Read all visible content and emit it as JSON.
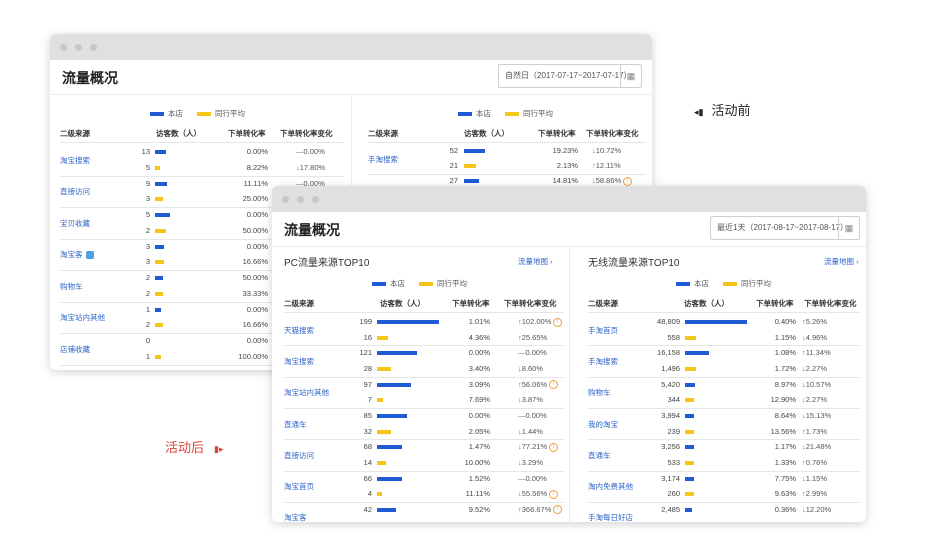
{
  "colors": {
    "self": "#1f5bd6",
    "peer": "#f5c518",
    "link": "#2d64c8",
    "up": "#e0443a",
    "down": "#2e9e3a",
    "after_label": "#e0443a"
  },
  "labels": {
    "before": "活动前",
    "after": "活动后",
    "before_icon": "◂▮",
    "after_icon": "▮▸"
  },
  "win1": {
    "title": "流量概况",
    "date": "自然日（2017-07-17~2017-07-17）",
    "legend": {
      "self": "本店",
      "peer": "同行平均"
    },
    "headers": [
      "二级来源",
      "访客数（人）",
      "下单转化率",
      "下单转化率变化"
    ],
    "left": {
      "rows": [
        {
          "name": "淘宝搜索",
          "tag": false,
          "v1": "13",
          "b1": 0.38,
          "v2": "5",
          "b2": 0.18,
          "r1": "0.00%",
          "r2": "8.22%",
          "c": "0.00%",
          "cd": "eq",
          "c2": "17.80%",
          "cd2": "down"
        },
        {
          "name": "直接访问",
          "tag": false,
          "v1": "9",
          "b1": 0.42,
          "v2": "3",
          "b2": 0.3,
          "r1": "11.11%",
          "r2": "25.00%",
          "c": "0.00%",
          "cd": "eq"
        },
        {
          "name": "宝贝收藏",
          "tag": false,
          "v1": "5",
          "b1": 0.55,
          "v2": "2",
          "b2": 0.38,
          "r1": "0.00%",
          "r2": "50.00%"
        },
        {
          "name": "淘宝客",
          "tag": true,
          "v1": "3",
          "b1": 0.33,
          "v2": "3",
          "b2": 0.33,
          "r1": "0.00%",
          "r2": "16.66%"
        },
        {
          "name": "购物车",
          "tag": false,
          "v1": "2",
          "b1": 0.3,
          "v2": "2",
          "b2": 0.3,
          "r1": "50.00%",
          "r2": "33.33%"
        },
        {
          "name": "淘宝站内其他",
          "tag": false,
          "v1": "1",
          "b1": 0.2,
          "v2": "2",
          "b2": 0.3,
          "r1": "0.00%",
          "r2": "16.66%"
        },
        {
          "name": "店铺收藏",
          "tag": false,
          "v1": "0",
          "b1": 0.0,
          "v2": "1",
          "b2": 0.2,
          "r1": "0.00%",
          "r2": "100.00%"
        }
      ]
    },
    "right": {
      "rows": [
        {
          "name": "手淘搜索",
          "v1": "52",
          "b1": 0.42,
          "v2": "21",
          "b2": 0.24,
          "v3": "27",
          "b3": 0.3,
          "r1": "19.23%",
          "r2": "2.13%",
          "r3": "14.81%",
          "c1": "10.72%",
          "cd1": "down",
          "c2": "12.11%",
          "cd2": "up",
          "c3": "58.86%",
          "cd3": "down"
        }
      ]
    }
  },
  "win2": {
    "title": "流量概况",
    "date": "最近1天（2017-08-17~2017-08-17）",
    "legend": {
      "self": "本店",
      "peer": "同行平均"
    },
    "headers": [
      "二级来源",
      "访客数（人）",
      "下单转化率",
      "下单转化率变化"
    ],
    "left": {
      "title": "PC流量来源TOP10",
      "map": "流量地图 ›",
      "rows": [
        {
          "name": "天猫搜索",
          "v1": "199",
          "b1": 1.0,
          "v2": "16",
          "b2": 0.18,
          "r1": "1.01%",
          "r2": "4.36%",
          "c1": "102.00%",
          "cd1": "up",
          "w1": true,
          "c2": "25.65%",
          "cd2": "up"
        },
        {
          "name": "淘宝搜索",
          "v1": "121",
          "b1": 0.65,
          "v2": "28",
          "b2": 0.22,
          "r1": "0.00%",
          "r2": "3.40%",
          "c1": "0.00%",
          "cd1": "eq",
          "c2": "8.60%",
          "cd2": "down"
        },
        {
          "name": "淘宝站内其他",
          "v1": "97",
          "b1": 0.55,
          "v2": "7",
          "b2": 0.1,
          "r1": "3.09%",
          "r2": "7.69%",
          "c1": "56.06%",
          "cd1": "up",
          "w1": true,
          "c2": "3.87%",
          "cd2": "down"
        },
        {
          "name": "直通车",
          "v1": "85",
          "b1": 0.48,
          "v2": "32",
          "b2": 0.22,
          "r1": "0.00%",
          "r2": "2.05%",
          "c1": "0.00%",
          "cd1": "eq",
          "c2": "1.44%",
          "cd2": "down"
        },
        {
          "name": "直接访问",
          "v1": "68",
          "b1": 0.4,
          "v2": "14",
          "b2": 0.14,
          "r1": "1.47%",
          "r2": "10.00%",
          "c1": "77.21%",
          "cd1": "down",
          "w1": true,
          "c2": "3.29%",
          "cd2": "down"
        },
        {
          "name": "淘宝首页",
          "v1": "66",
          "b1": 0.4,
          "v2": "4",
          "b2": 0.08,
          "r1": "1.52%",
          "r2": "11.11%",
          "c1": "0.00%",
          "cd1": "eq",
          "c2": "55.56%",
          "cd2": "down",
          "w2": true
        },
        {
          "name": "淘宝客",
          "v1": "42",
          "b1": 0.3,
          "v2": "",
          "b2": 0.0,
          "r1": "9.52%",
          "r2": "",
          "c1": "366.67%",
          "cd1": "up",
          "w1": true,
          "c2": "",
          "cd2": "eq"
        }
      ]
    },
    "right": {
      "title": "无线流量来源TOP10",
      "map": "流量地图 ›",
      "rows": [
        {
          "name": "手淘首页",
          "v1": "48,809",
          "b1": 1.0,
          "v2": "558",
          "b2": 0.18,
          "r1": "0.40%",
          "r2": "1.15%",
          "c1": "5.26%",
          "cd1": "up",
          "c2": "4.96%",
          "cd2": "down"
        },
        {
          "name": "手淘搜索",
          "v1": "16,158",
          "b1": 0.38,
          "v2": "1,496",
          "b2": 0.18,
          "r1": "1.08%",
          "r2": "1.72%",
          "c1": "11.34%",
          "cd1": "up",
          "c2": "2.27%",
          "cd2": "down"
        },
        {
          "name": "购物车",
          "v1": "5,420",
          "b1": 0.16,
          "v2": "344",
          "b2": 0.14,
          "r1": "8.97%",
          "r2": "12.90%",
          "c1": "10.57%",
          "cd1": "down",
          "c2": "2.27%",
          "cd2": "down"
        },
        {
          "name": "我的淘宝",
          "v1": "3,994",
          "b1": 0.14,
          "v2": "239",
          "b2": 0.14,
          "r1": "8.64%",
          "r2": "13.56%",
          "c1": "15.13%",
          "cd1": "down",
          "c2": "1.73%",
          "cd2": "up"
        },
        {
          "name": "直通车",
          "v1": "3,256",
          "b1": 0.14,
          "v2": "533",
          "b2": 0.14,
          "r1": "1.17%",
          "r2": "1.33%",
          "c1": "21.48%",
          "cd1": "down",
          "c2": "0.76%",
          "cd2": "up"
        },
        {
          "name": "淘内免费其他",
          "v1": "3,174",
          "b1": 0.14,
          "v2": "260",
          "b2": 0.14,
          "r1": "7.75%",
          "r2": "9.63%",
          "c1": "1.15%",
          "cd1": "down",
          "c2": "2.99%",
          "cd2": "up"
        },
        {
          "name": "手淘每日好店",
          "v1": "2,485",
          "b1": 0.12,
          "v2": "",
          "b2": 0.0,
          "r1": "0.36%",
          "r2": "",
          "c1": "12.20%",
          "cd1": "down",
          "c2": "",
          "cd2": "eq"
        }
      ]
    }
  }
}
